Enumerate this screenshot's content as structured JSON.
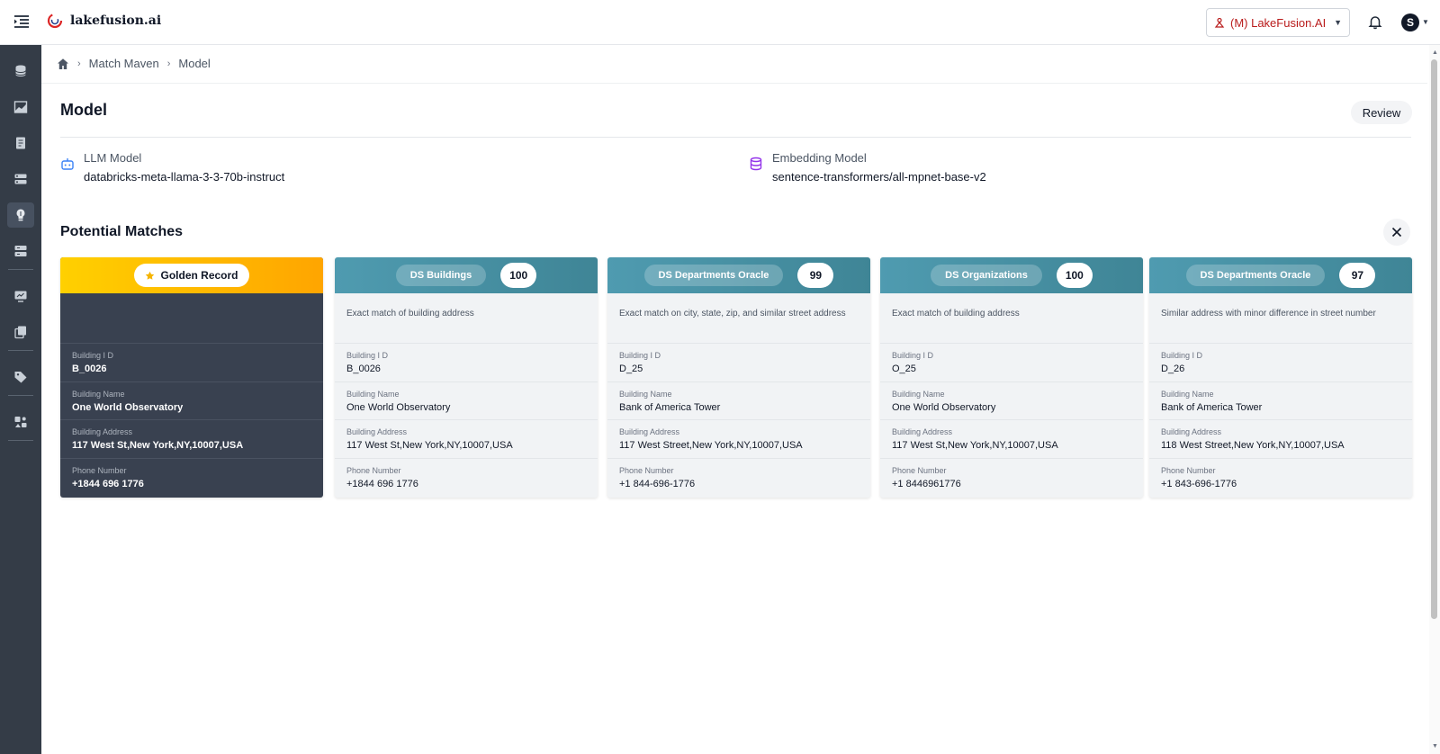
{
  "header": {
    "logo_text": "lakefusion.ai",
    "org_selector": "(M) LakeFusion.AI",
    "user_initial": "S"
  },
  "sidebar": {
    "items": [
      {
        "icon": "database-icon"
      },
      {
        "icon": "image-chart-icon"
      },
      {
        "icon": "document-icon"
      },
      {
        "icon": "list-cards-icon"
      },
      {
        "icon": "match-maven-icon",
        "active": true
      },
      {
        "icon": "server-stack-icon"
      },
      {
        "icon": "monitor-report-icon"
      },
      {
        "icon": "copy-files-icon"
      },
      {
        "icon": "tag-icon"
      },
      {
        "icon": "user-grid-icon"
      }
    ]
  },
  "breadcrumb": {
    "home_icon": "home-icon",
    "items": [
      "Match Maven",
      "Model"
    ]
  },
  "page": {
    "title": "Model",
    "review_label": "Review"
  },
  "models": {
    "llm": {
      "label": "LLM Model",
      "value": "databricks-meta-llama-3-3-70b-instruct",
      "icon": "robot-icon"
    },
    "embedding": {
      "label": "Embedding Model",
      "value": "sentence-transformers/all-mpnet-base-v2",
      "icon": "database-icon"
    }
  },
  "matches": {
    "title": "Potential Matches",
    "close_icon": "close-icon",
    "golden": {
      "label": "Golden Record",
      "fields": [
        {
          "label": "Building I D",
          "value": "B_0026"
        },
        {
          "label": "Building Name",
          "value": "One World Observatory"
        },
        {
          "label": "Building Address",
          "value": "117 West St,New York,NY,10007,USA"
        },
        {
          "label": "Phone Number",
          "value": "+1844 696 1776"
        }
      ]
    },
    "cards": [
      {
        "source": "DS Buildings",
        "score": "100",
        "reason": "Exact match of building address",
        "fields": [
          {
            "label": "Building I D",
            "value": "B_0026"
          },
          {
            "label": "Building Name",
            "value": "One World Observatory"
          },
          {
            "label": "Building Address",
            "value": "117 West St,New York,NY,10007,USA"
          },
          {
            "label": "Phone Number",
            "value": "+1844 696 1776"
          }
        ]
      },
      {
        "source": "DS Departments Oracle",
        "score": "99",
        "reason": "Exact match on city, state, zip, and similar street address",
        "fields": [
          {
            "label": "Building I D",
            "value": "D_25"
          },
          {
            "label": "Building Name",
            "value": "Bank of America Tower"
          },
          {
            "label": "Building Address",
            "value": "117 West Street,New York,NY,10007,USA"
          },
          {
            "label": "Phone Number",
            "value": "+1 844-696-1776"
          }
        ]
      },
      {
        "source": "DS Organizations",
        "score": "100",
        "reason": "Exact match of building address",
        "fields": [
          {
            "label": "Building I D",
            "value": "O_25"
          },
          {
            "label": "Building Name",
            "value": "One World Observatory"
          },
          {
            "label": "Building Address",
            "value": "117 West St,New York,NY,10007,USA"
          },
          {
            "label": "Phone Number",
            "value": "+1 8446961776"
          }
        ]
      },
      {
        "source": "DS Departments Oracle",
        "score": "97",
        "reason": "Similar address with minor difference in street number",
        "fields": [
          {
            "label": "Building I D",
            "value": "D_26"
          },
          {
            "label": "Building Name",
            "value": "Bank of America Tower"
          },
          {
            "label": "Building Address",
            "value": "118 West Street,New York,NY,10007,USA"
          },
          {
            "label": "Phone Number",
            "value": "+1 843-696-1776"
          }
        ]
      }
    ]
  },
  "colors": {
    "golden_gradient_start": "#ffd000",
    "golden_gradient_end": "#ffa500",
    "source_header": "#4f9bb0",
    "sidebar_bg": "#343c47",
    "golden_body": "#394150",
    "org_text": "#b91c1c"
  }
}
